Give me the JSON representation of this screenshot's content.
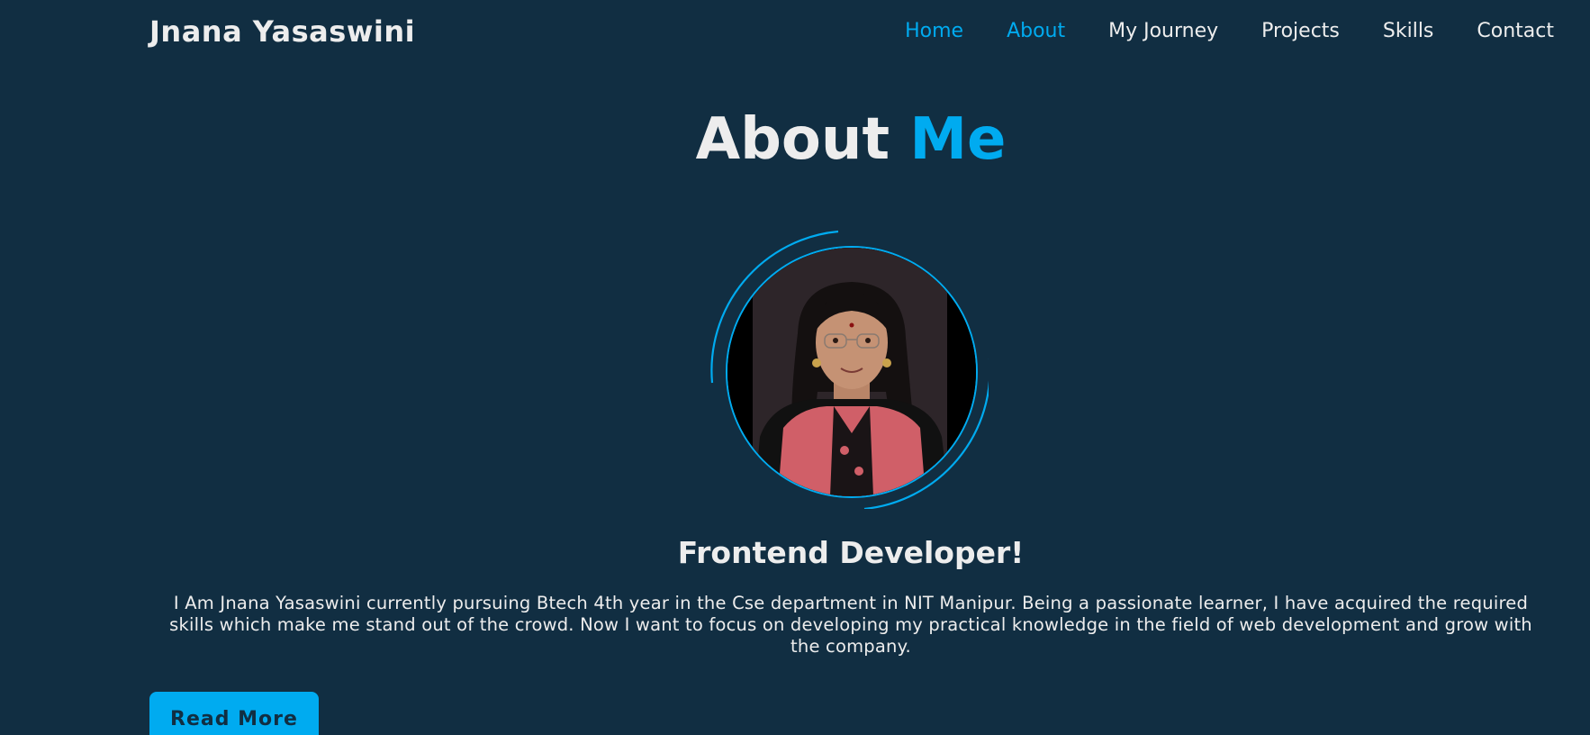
{
  "header": {
    "logo": "Jnana Yasaswini",
    "nav": [
      {
        "label": "Home",
        "active": true
      },
      {
        "label": "About",
        "active": true
      },
      {
        "label": "My Journey",
        "active": false
      },
      {
        "label": "Projects",
        "active": false
      },
      {
        "label": "Skills",
        "active": false
      },
      {
        "label": "Contact",
        "active": false
      }
    ]
  },
  "about": {
    "title_main": "About",
    "title_accent": "Me",
    "subtitle": "Frontend Developer!",
    "bio": "I Am Jnana Yasaswini currently pursuing Btech 4th year in the Cse department in NIT Manipur. Being a passionate learner, I have acquired the required skills which make me stand out of the crowd. Now I want to focus on developing my practical knowledge in the field of web development and grow with the company.",
    "button_label": "Read More"
  },
  "colors": {
    "background": "#112e42",
    "accent": "#00abf0",
    "text": "#ededed"
  }
}
